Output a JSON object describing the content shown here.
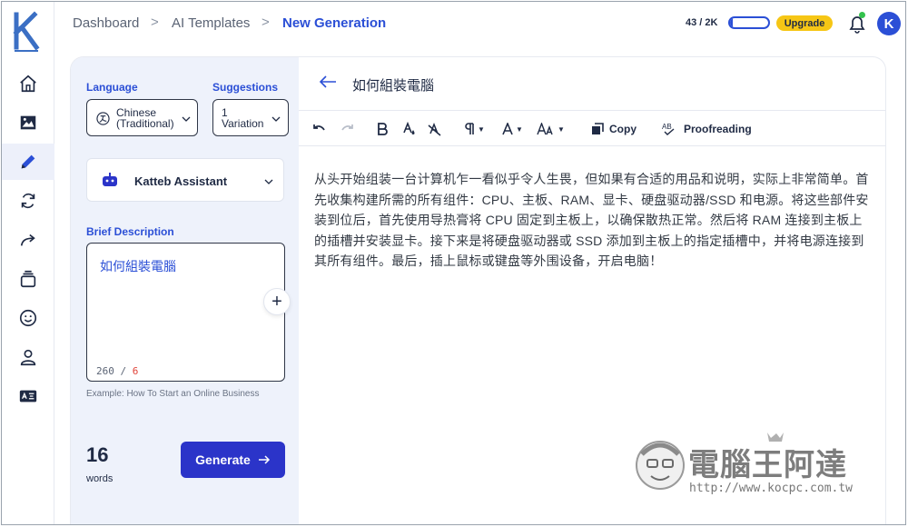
{
  "app": {
    "logo_letter": "K"
  },
  "breadcrumb": {
    "items": [
      "Dashboard",
      "AI Templates",
      "New Generation"
    ],
    "separator": ">"
  },
  "header": {
    "usage_text": "43 / 2K",
    "usage_fraction": 0.0215,
    "upgrade_label": "Upgrade",
    "avatar_letter": "K",
    "colors": {
      "accent": "#2b4fd6",
      "upgrade": "#f6c615",
      "notification": "#33c24d"
    }
  },
  "sidebar": {
    "icons": [
      "home-icon",
      "image-icon",
      "pencil-icon",
      "refresh-icon",
      "share-icon",
      "layers-icon",
      "smiley-icon",
      "user-icon",
      "id-card-icon"
    ],
    "active": "pencil-icon"
  },
  "form": {
    "language_label": "Language",
    "language_value_line1": "Chinese",
    "language_value_line2": "(Traditional)",
    "suggestions_label": "Suggestions",
    "suggestions_value_line1": "1",
    "suggestions_value_line2": "Variation",
    "assistant_name": "Katteb Assistant",
    "brief_label": "Brief Description",
    "brief_value": "如何組裝電腦",
    "counter_left": "260",
    "counter_sep": "/",
    "counter_right": "6",
    "example": "Example: How To Start an Online Business",
    "words_count": "16",
    "words_label": "words",
    "generate_label": "Generate"
  },
  "editor": {
    "title": "如何組裝電腦",
    "toolbar": {
      "copy_label": "Copy",
      "proofreading_label": "Proofreading"
    },
    "content": "从头开始组装一台计算机乍一看似乎令人生畏，但如果有合适的用品和说明，实际上非常简单。首先收集构建所需的所有组件：CPU、主板、RAM、显卡、硬盘驱动器/SSD 和电源。将这些部件安装到位后，首先使用导热膏将 CPU 固定到主板上，以确保散热正常。然后将 RAM 连接到主板上的插槽并安装显卡。接下来是将硬盘驱动器或 SSD 添加到主板上的指定插槽中，并将电源连接到其所有组件。最后，插上鼠标或键盘等外围设备，开启电脑！"
  },
  "watermark": {
    "text": "電腦王阿達",
    "url": "http://www.kocpc.com.tw"
  }
}
